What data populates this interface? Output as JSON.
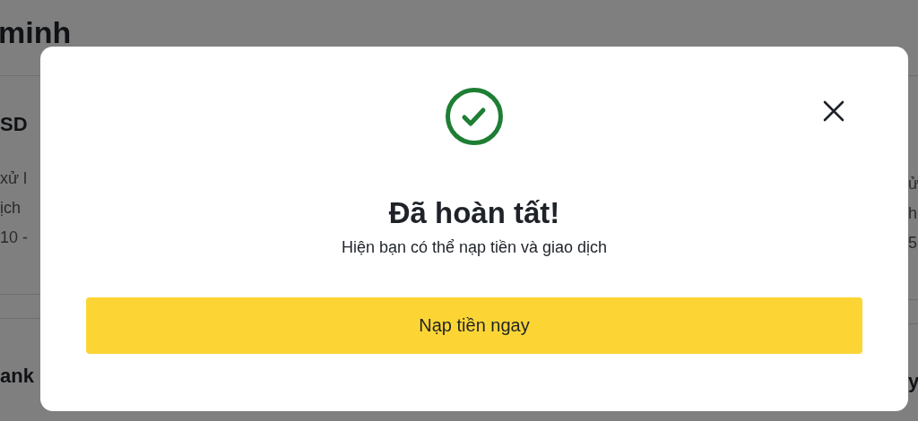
{
  "background": {
    "title": "minh",
    "left": [
      {
        "text": "SD",
        "kind": "heading"
      },
      {
        "text": "xử l",
        "kind": "line"
      },
      {
        "text": "ịch",
        "kind": "line"
      },
      {
        "text": "10 -",
        "kind": "line"
      },
      {
        "text": "ank",
        "kind": "heading"
      }
    ],
    "right": [
      {
        "text": "ử",
        "kind": "line"
      },
      {
        "text": "h",
        "kind": "line"
      },
      {
        "text": "5",
        "kind": "line"
      },
      {
        "text": "y",
        "kind": "heading"
      }
    ]
  },
  "dialog": {
    "title": "Đã hoàn tất!",
    "message": "Hiện bạn có thể nạp tiền và giao dịch",
    "button": "Nạp tiền ngay"
  }
}
